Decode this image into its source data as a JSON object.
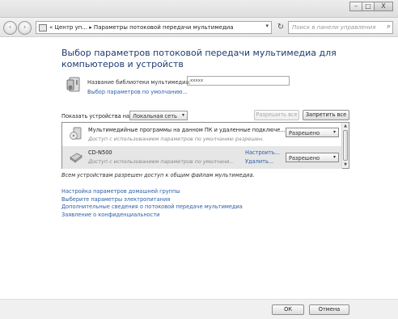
{
  "window": {
    "minimize_glyph": "–",
    "maximize_glyph": "□",
    "close_glyph": "X"
  },
  "nav": {
    "back_glyph": "‹",
    "forward_glyph": "›",
    "address": "« Центр уп... ▸ Параметры потоковой передачи мультимедиа",
    "address_dropdown_glyph": "▾",
    "refresh_glyph": "↻",
    "search_placeholder": "Поиск в панели управления",
    "search_glyph": "⌕"
  },
  "main": {
    "heading": "Выбор параметров потоковой передачи мультимедиа для компьютеров и устройств",
    "library_label": "Название библиотеки мультимедиа:",
    "library_value": "xxxxx",
    "library_link": "Выбор параметров по умолчанию...",
    "show_devices_label": "Показать устройства на:",
    "show_devices_value": "Локальная сеть",
    "allow_all_button": "Разрешить все",
    "block_all_button": "Запретить все"
  },
  "devices": [
    {
      "name": "Мультимедийные программы на данном ПК и удаленные подключе...",
      "description": "Доступ с использованием параметров по умолчанию разрешен.",
      "link": "",
      "link2": "",
      "status": "Разрешено",
      "icon": "media-program-icon"
    },
    {
      "name": "CD-N500",
      "description": "Доступ с использованием параметров по умолчани...",
      "link": "Настроить...",
      "link2": "Удалить...",
      "status": "Разрешено",
      "icon": "device-icon"
    }
  ],
  "allow_note": "Всем устройствам разрешен доступ к общим файлам мультимедиа.",
  "links": [
    "Настройка параметров домашней группы",
    "Выберите параметры электропитания",
    "Дополнительные сведения о потоковой передаче мультимедиа",
    "Заявление о конфиденциальности"
  ],
  "footer": {
    "ok": "ОК",
    "cancel": "Отмена"
  },
  "dropdown_glyph": "▾"
}
